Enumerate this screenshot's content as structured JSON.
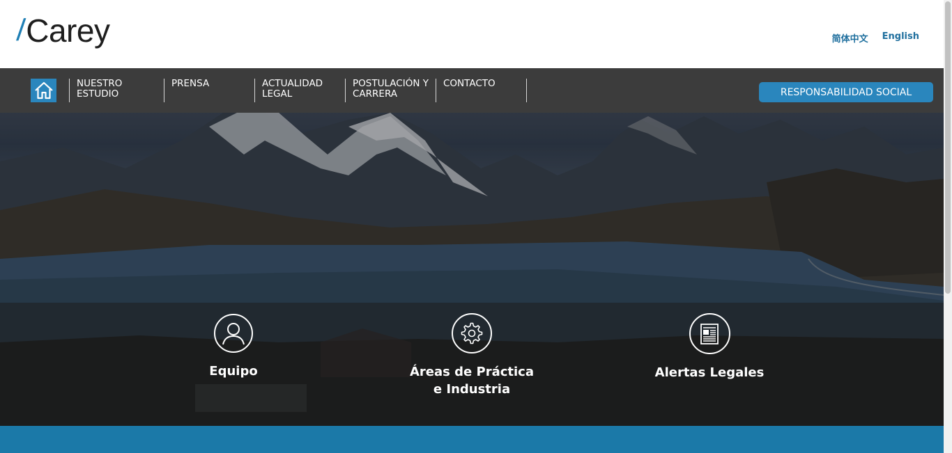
{
  "header": {
    "logo_text": "Carey",
    "languages": [
      "简体中文",
      "English"
    ]
  },
  "nav": {
    "home_icon": "house-icon",
    "items": [
      {
        "line1": "NUESTRO",
        "line2": "ESTUDIO"
      },
      {
        "line1": "PRENSA",
        "line2": ""
      },
      {
        "line1": "ACTUALIDAD",
        "line2": "LEGAL"
      },
      {
        "line1": "POSTULACIÓN Y",
        "line2": "CARRERA"
      },
      {
        "line1": "CONTACTO",
        "line2": ""
      }
    ],
    "cta_label": "RESPONSABILIDAD SOCIAL"
  },
  "features": [
    {
      "icon": "user-icon",
      "line1": "Equipo",
      "line2": ""
    },
    {
      "icon": "gear-icon",
      "line1": "Áreas de Práctica",
      "line2": "e Industria"
    },
    {
      "icon": "newspaper-icon",
      "line1": "Alertas Legales",
      "line2": ""
    }
  ],
  "colors": {
    "accent": "#2a86bd",
    "navbar": "#3c3c3c",
    "footer_band": "#1b79a8",
    "link": "#1f6f9e"
  }
}
